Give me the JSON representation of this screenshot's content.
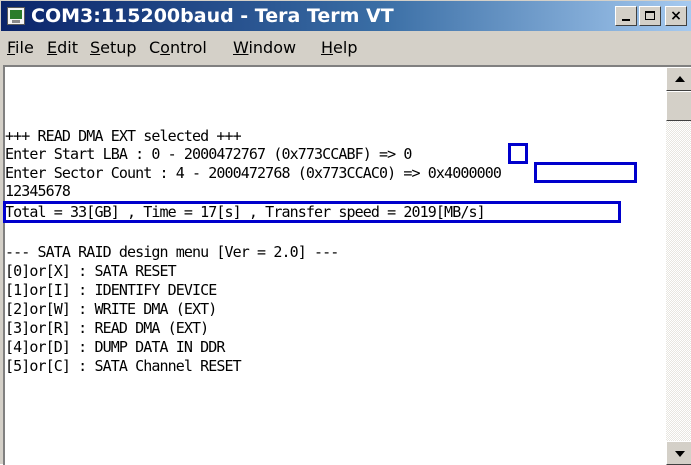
{
  "window": {
    "title": "COM3:115200baud - Tera Term VT",
    "icon": "tera-term-icon",
    "controls": {
      "minimize": "minimize-icon",
      "maximize": "maximize-icon",
      "close": "close-icon",
      "close_glyph": "×"
    }
  },
  "menu": {
    "items": [
      {
        "label": "File",
        "mnemonic": "F"
      },
      {
        "label": "Edit",
        "mnemonic": "E"
      },
      {
        "label": "Setup",
        "mnemonic": "S"
      },
      {
        "label": "Control",
        "mnemonic": "o"
      },
      {
        "label": "Window",
        "mnemonic": "W"
      },
      {
        "label": "Help",
        "mnemonic": "H"
      }
    ]
  },
  "terminal": {
    "lines": [
      "+++ READ DMA EXT selected +++",
      "Enter Start LBA : 0 - 2000472767 (0x773CCABF) => 0",
      "Enter Sector Count : 4 - 2000472768 (0x773CCAC0) => 0x4000000",
      "12345678",
      "Total = 33[GB] , Time = 17[s] , Transfer speed = 2019[MB/s]",
      "",
      "--- SATA RAID design menu [Ver = 2.0] ---",
      "[0]or[X] : SATA RESET",
      "[1]or[I] : IDENTIFY DEVICE",
      "[2]or[W] : WRITE DMA (EXT)",
      "[3]or[R] : READ DMA (EXT)",
      "[4]or[D] : DUMP DATA IN DDR",
      "[5]or[C] : SATA Channel RESET"
    ],
    "highlight_color": "#0000cc"
  },
  "scrollbar": {
    "up": "scroll-up-arrow-icon",
    "down": "scroll-down-arrow-icon"
  }
}
